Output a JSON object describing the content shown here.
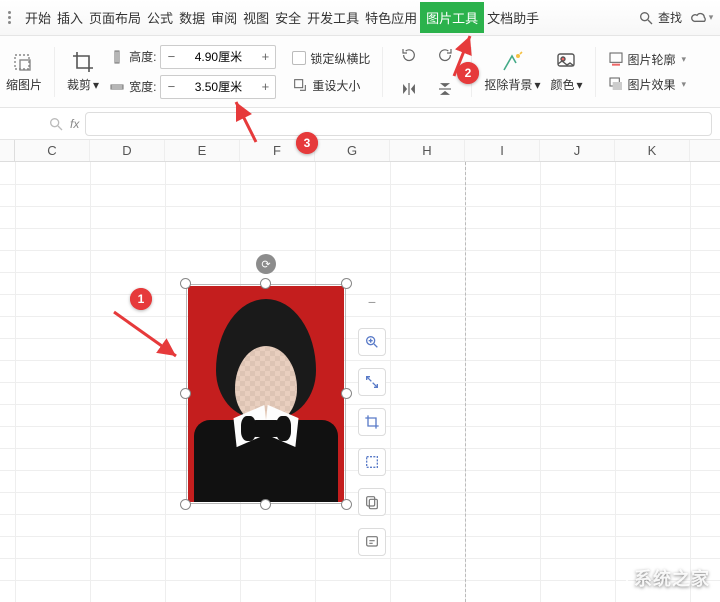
{
  "tabs": {
    "items": [
      "开始",
      "插入",
      "页面布局",
      "公式",
      "数据",
      "审阅",
      "视图",
      "安全",
      "开发工具",
      "特色应用",
      "图片工具",
      "文档助手"
    ],
    "active_index": 10,
    "search_label": "查找"
  },
  "ribbon": {
    "compress_label": "缩图片",
    "crop_label": "裁剪",
    "height_label": "高度:",
    "width_label": "宽度:",
    "height_value": "4.90厘米",
    "width_value": "3.50厘米",
    "lock_ratio_label": "锁定纵横比",
    "reset_size_label": "重设大小",
    "remove_bg_label": "抠除背景",
    "color_label": "颜色",
    "outline_label": "图片轮廓",
    "effects_label": "图片效果"
  },
  "formula": {
    "fx": "fx"
  },
  "columns": [
    "C",
    "D",
    "E",
    "F",
    "G",
    "H",
    "I",
    "J",
    "K"
  ],
  "annotations": {
    "b1": "1",
    "b2": "2",
    "b3": "3"
  },
  "watermark": {
    "text": "系统之家"
  }
}
